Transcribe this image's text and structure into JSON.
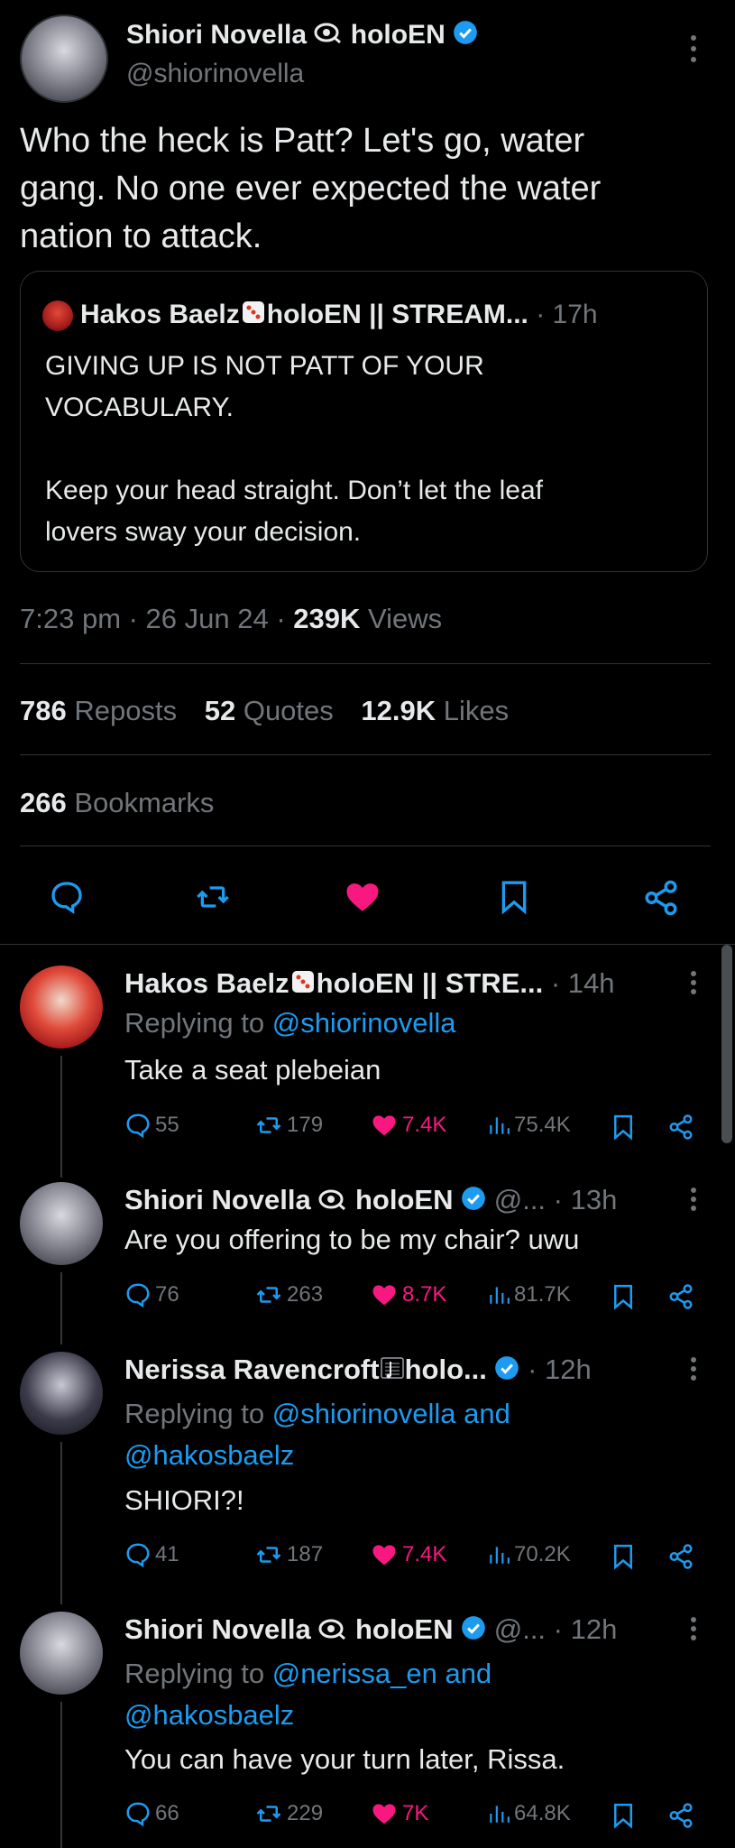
{
  "main_tweet": {
    "author_name": "Shiori Novella",
    "author_suffix": "holoEN",
    "handle": "@shiorinovella",
    "text_lines": [
      "Who the heck is Patt? Let's go, water",
      "gang. No one ever expected the water",
      "nation to attack."
    ],
    "quoted": {
      "author": "Hakos Baelz",
      "author_suffix": "holoEN || STREAM...",
      "time": "· 17h",
      "text_lines": [
        "GIVING UP IS NOT PATT OF YOUR",
        "VOCABULARY.",
        "",
        "Keep your head straight. Don’t let the leaf",
        "lovers sway your decision."
      ]
    },
    "timestamp": "7:23 pm · 26 Jun 24 ·",
    "views_count": "239K",
    "views_label": "Views",
    "reposts_count": "786",
    "reposts_label": "Reposts",
    "quotes_count": "52",
    "quotes_label": "Quotes",
    "likes_count": "12.9K",
    "likes_label": "Likes",
    "bookmarks_count": "266",
    "bookmarks_label": "Bookmarks"
  },
  "replies": [
    {
      "author": "Hakos Baelz",
      "suffix": "holoEN || STRE...",
      "handle": "",
      "time": "· 14h",
      "replying_prefix": "Replying to",
      "replying_to": "@shiorinovella",
      "replying_to_2": "",
      "text": "Take a seat plebeian",
      "replies": "55",
      "reposts": "179",
      "likes": "7.4K",
      "views": "75.4K"
    },
    {
      "author": "Shiori Novella",
      "suffix": "holoEN",
      "handle": "@...",
      "time": "· 13h",
      "replying_prefix": "",
      "replying_to": "",
      "replying_to_2": "",
      "text": "Are you offering to be my chair? uwu",
      "replies": "76",
      "reposts": "263",
      "likes": "8.7K",
      "views": "81.7K"
    },
    {
      "author": "Nerissa Ravencroft",
      "suffix": "holo...",
      "handle": "",
      "time": "· 12h",
      "replying_prefix": "Replying to",
      "replying_to": "@shiorinovella and",
      "replying_to_2": "@hakosbaelz",
      "text": "SHIORI?!",
      "replies": "41",
      "reposts": "187",
      "likes": "7.4K",
      "views": "70.2K"
    },
    {
      "author": "Shiori Novella",
      "suffix": "holoEN",
      "handle": "@...",
      "time": "· 12h",
      "replying_prefix": "Replying to",
      "replying_to": "@nerissa_en and",
      "replying_to_2": "@hakosbaelz",
      "text": "You can have your turn later, Rissa.",
      "replies": "66",
      "reposts": "229",
      "likes": "7K",
      "views": "64.8K"
    }
  ],
  "colors": {
    "accent": "#1d9bf0",
    "like": "#f91880",
    "muted": "#71767b",
    "text": "#e7e9ea",
    "bg": "#000000"
  },
  "icons": [
    "more-icon",
    "verified-icon",
    "reply-icon",
    "repost-icon",
    "like-icon",
    "bookmark-icon",
    "share-icon",
    "views-icon",
    "dice-icon",
    "eye-icon",
    "music-icon"
  ]
}
